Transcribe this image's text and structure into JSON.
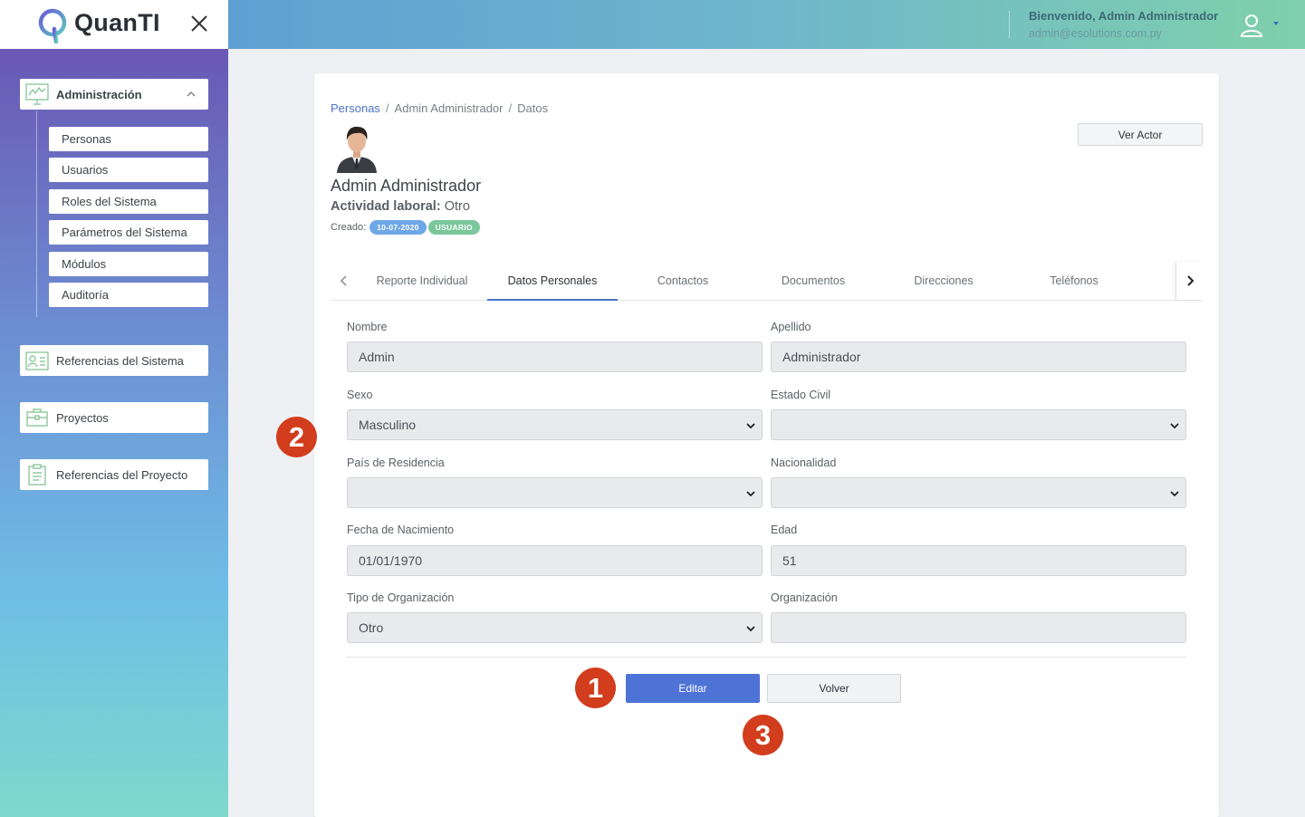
{
  "brand": {
    "name": "QuanTI"
  },
  "header": {
    "welcome": "Bienvenido, Admin Administrador",
    "email": "admin@esolutions.com.py"
  },
  "sidebar": {
    "admin_label": "Administración",
    "sub_items": [
      "Personas",
      "Usuarios",
      "Roles del Sistema",
      "Parámetros del Sistema",
      "Módulos",
      "Auditoría"
    ],
    "references_label": "Referencias del Sistema",
    "projects_label": "Proyectos",
    "project_refs_label": "Referencias del Proyecto"
  },
  "breadcrumb": [
    "Personas",
    "Admin Administrador",
    "Datos"
  ],
  "person": {
    "name": "Admin Administrador",
    "activity_label": "Actividad laboral:",
    "activity_value": "Otro",
    "created_label": "Creado:",
    "created_date": "10-07-2020",
    "role_badge": "USUARIO"
  },
  "ver_actor_label": "Ver Actor",
  "tabs": [
    "Reporte Individual",
    "Datos Personales",
    "Contactos",
    "Documentos",
    "Direcciones",
    "Teléfonos"
  ],
  "active_tab": "Datos Personales",
  "form": {
    "nombre_label": "Nombre",
    "nombre_value": "Admin",
    "apellido_label": "Apellido",
    "apellido_value": "Administrador",
    "sexo_label": "Sexo",
    "sexo_value": "Masculino",
    "estado_civil_label": "Estado Civil",
    "estado_civil_value": "",
    "pais_label": "País de Residencia",
    "pais_value": "",
    "nacionalidad_label": "Nacionalidad",
    "nacionalidad_value": "",
    "fecha_label": "Fecha de Nacimiento",
    "fecha_value": "01/01/1970",
    "edad_label": "Edad",
    "edad_value": "51",
    "tipo_org_label": "Tipo de Organización",
    "tipo_org_value": "Otro",
    "org_label": "Organización",
    "org_value": ""
  },
  "buttons": {
    "edit": "Editar",
    "back": "Volver"
  },
  "markers": [
    "1",
    "2",
    "3"
  ],
  "colors": {
    "accent": "#4e73d6",
    "marker": "#d23d1d",
    "badge_date": "#6fa7e6",
    "badge_role": "#79c79a"
  }
}
